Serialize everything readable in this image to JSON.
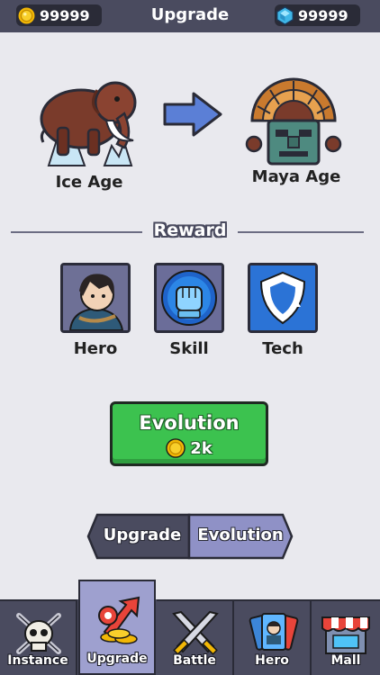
{
  "header": {
    "coins": "99999",
    "title": "Upgrade",
    "gems": "99999"
  },
  "evolution": {
    "from_age": "Ice Age",
    "to_age": "Maya Age"
  },
  "reward": {
    "title": "Reward",
    "items": [
      {
        "label": "Hero",
        "icon": "hero-portrait-icon"
      },
      {
        "label": "Skill",
        "icon": "fist-icon"
      },
      {
        "label": "Tech",
        "icon": "shield-tech-icon"
      }
    ]
  },
  "evolve_button": {
    "label": "Evolution",
    "cost": "2k"
  },
  "mode_toggle": {
    "left": "Upgrade",
    "right": "Evolution",
    "selected": "Evolution"
  },
  "nav": {
    "items": [
      {
        "label": "Instance",
        "icon": "skull-swords-icon"
      },
      {
        "label": "Upgrade",
        "icon": "upgrade-arrow-coins-icon",
        "active": true
      },
      {
        "label": "Battle",
        "icon": "crossed-swords-icon"
      },
      {
        "label": "Hero",
        "icon": "hero-cards-icon"
      },
      {
        "label": "Mall",
        "icon": "shop-stall-icon"
      }
    ]
  },
  "colors": {
    "topbar": "#4a4b5f",
    "background": "#e9e9ee",
    "evolve_green": "#3cc24f",
    "active_tab": "#9ea0cf",
    "arrow_blue": "#5b7fd6"
  }
}
